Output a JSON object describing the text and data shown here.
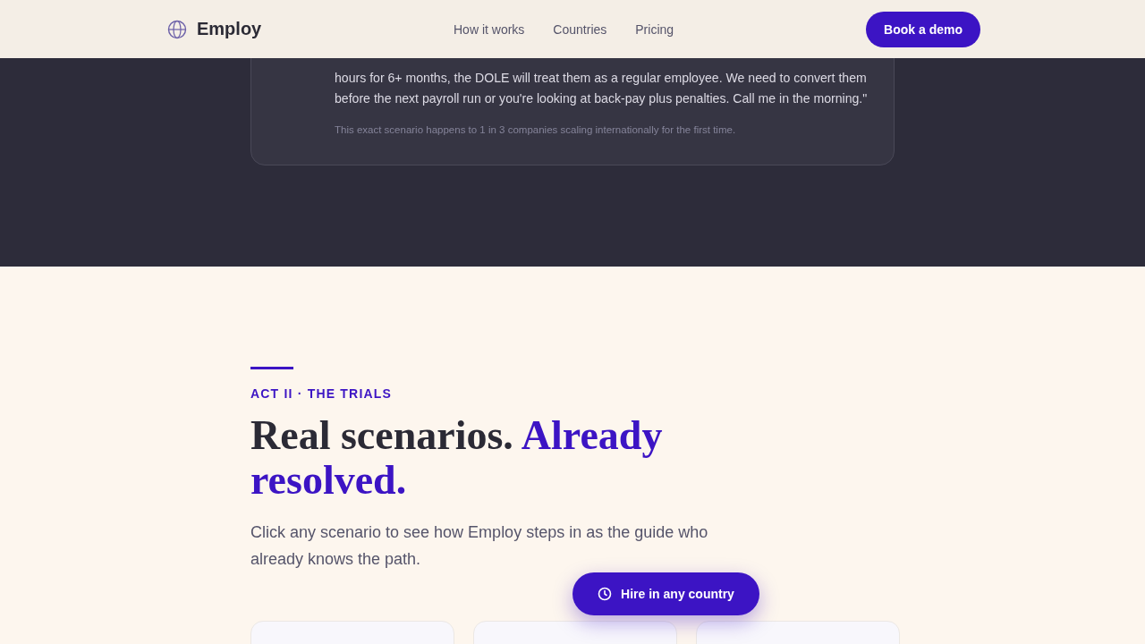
{
  "header": {
    "brand": "Employ",
    "nav": [
      {
        "label": "How it works"
      },
      {
        "label": "Countries"
      },
      {
        "label": "Pricing"
      }
    ],
    "cta": "Book a demo"
  },
  "story": {
    "quote_lines": [
      "hours for 6+ months, the DOLE will treat them as a regular employee. We need to convert them",
      "before the next payroll run or you're looking at back-pay plus penalties. Call me in the morning.\""
    ],
    "note": "This exact scenario happens to 1 in 3 companies scaling internationally for the first time."
  },
  "section": {
    "eyebrow": "ACT II · THE TRIALS",
    "title": "Real scenarios.",
    "title_accent": "Already resolved.",
    "intro": "Click any scenario to see how Employ steps in as the guide who already knows the path."
  },
  "floating_button": "Hire in any country"
}
